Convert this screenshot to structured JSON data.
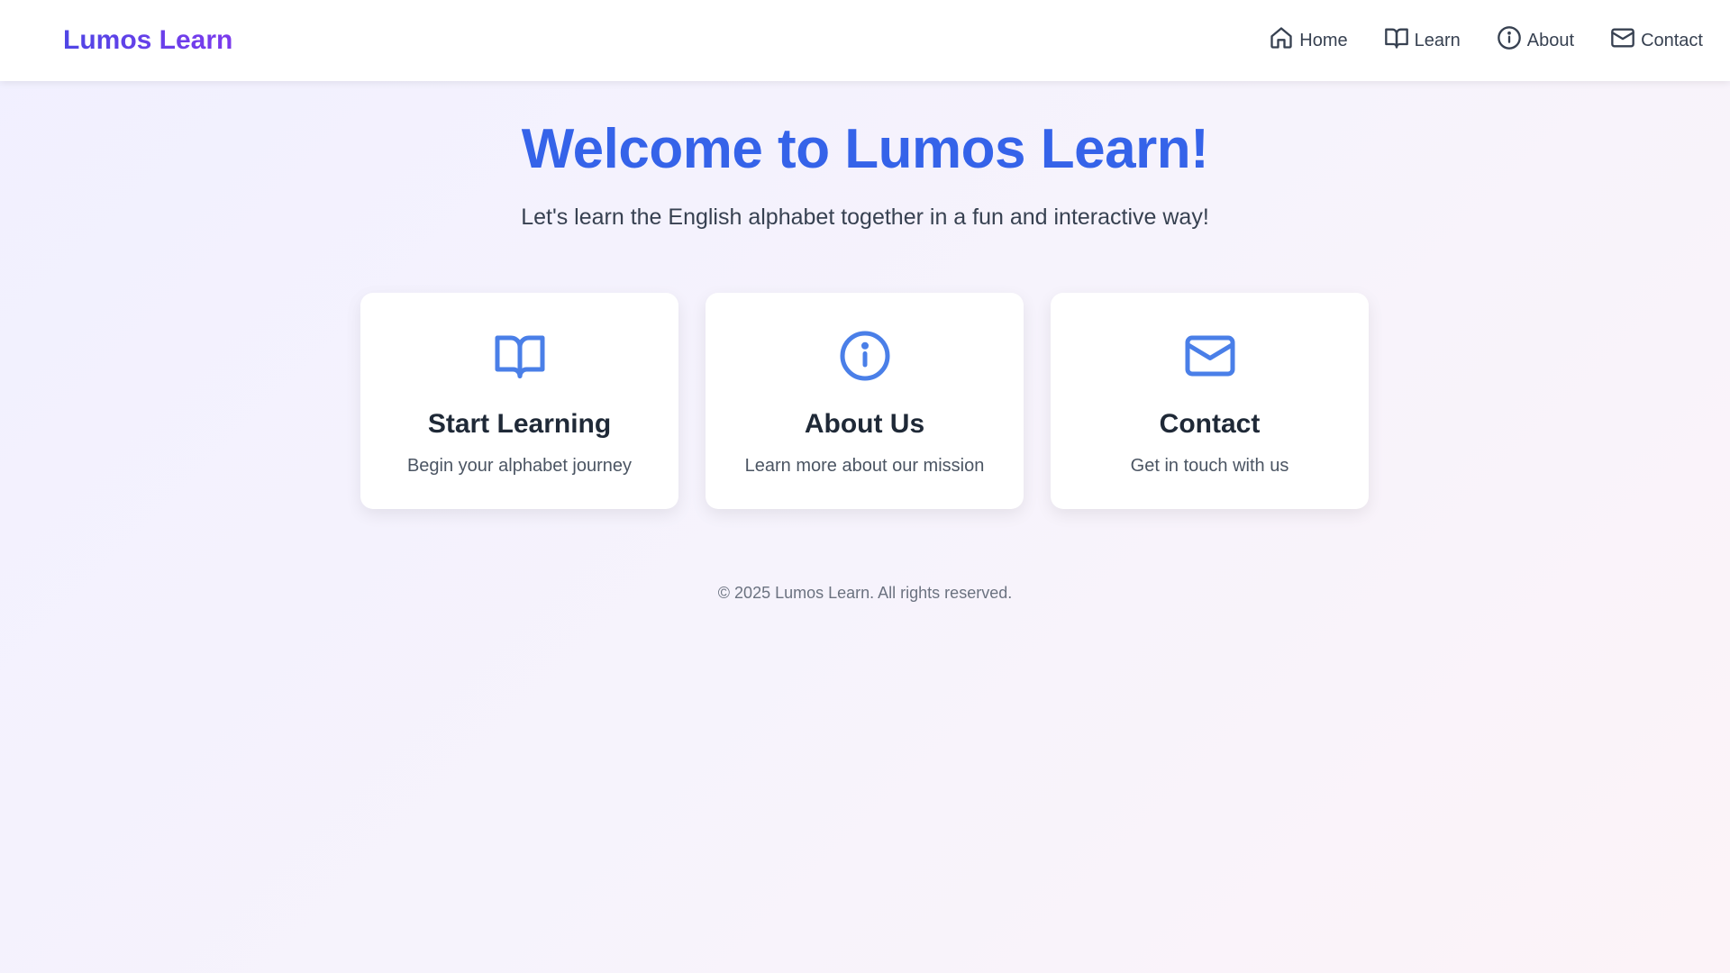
{
  "brand": {
    "name": "Lumos Learn"
  },
  "nav": {
    "items": [
      {
        "label": "Home",
        "icon": "home-icon"
      },
      {
        "label": "Learn",
        "icon": "book-icon"
      },
      {
        "label": "About",
        "icon": "info-icon"
      },
      {
        "label": "Contact",
        "icon": "mail-icon"
      }
    ]
  },
  "hero": {
    "title": "Welcome to Lumos Learn!",
    "subtitle": "Let's learn the English alphabet together in a fun and interactive way!"
  },
  "cards": [
    {
      "title": "Start Learning",
      "description": "Begin your alphabet journey",
      "icon": "book-icon"
    },
    {
      "title": "About Us",
      "description": "Learn more about our mission",
      "icon": "info-icon"
    },
    {
      "title": "Contact",
      "description": "Get in touch with us",
      "icon": "mail-icon"
    }
  ],
  "footer": {
    "text": "© 2025 Lumos Learn. All rights reserved."
  },
  "colors": {
    "brand_purple": "#6d3fe0",
    "accent_blue": "#3563e9",
    "icon_blue": "#4a7fe8",
    "text_dark": "#1f2937"
  }
}
